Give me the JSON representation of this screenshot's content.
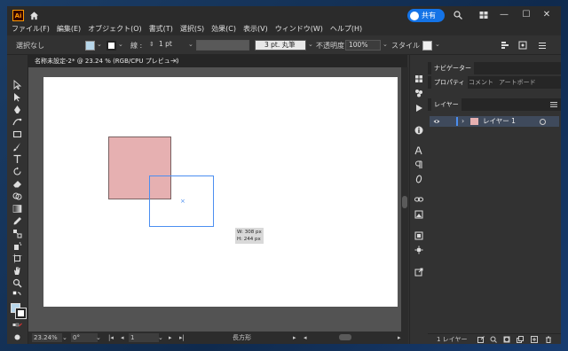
{
  "app": {
    "logo": "Ai",
    "home_icon": "home-icon",
    "share_label": "共有",
    "colors": {
      "accent": "#1473e6",
      "artwork_fill": "#e6b0b1",
      "selection": "#4b8ef0",
      "brand": "#ff9a00"
    }
  },
  "menu": [
    {
      "label": "ファイル(F)"
    },
    {
      "label": "編集(E)"
    },
    {
      "label": "オブジェクト(O)"
    },
    {
      "label": "書式(T)"
    },
    {
      "label": "選択(S)"
    },
    {
      "label": "効果(C)"
    },
    {
      "label": "表示(V)"
    },
    {
      "label": "ウィンドウ(W)"
    },
    {
      "label": "ヘルプ(H)"
    }
  ],
  "window_controls": {
    "minimize": "—",
    "maximize": "☐",
    "close": "✕"
  },
  "control_bar": {
    "selection_label": "選択なし",
    "stroke_label": "線 :",
    "stroke_weight": "1 pt",
    "brush_label": "3 pt. 丸筆",
    "opacity_label": "不透明度 :",
    "opacity_value": "100%",
    "style_label": "スタイル :"
  },
  "document_tab": {
    "title": "名称未設定-2* @ 23.24 % (RGB/CPU プレビュー)",
    "close": "×"
  },
  "canvas": {
    "tooltip_w": "W: 308 px",
    "tooltip_h": "H: 244 px",
    "center_mark": "×"
  },
  "status_bar": {
    "zoom": "23.24%",
    "rotation": "0°",
    "artboard_number": "1",
    "tool_name": "長方形"
  },
  "panels": {
    "tabs_top": [
      {
        "label": "ナビゲーター"
      }
    ],
    "tabs_mid": [
      {
        "label": "プロパティ"
      },
      {
        "label": "コメント"
      },
      {
        "label": "アートボード"
      }
    ],
    "tabs_layers": [
      {
        "label": "レイヤー"
      }
    ],
    "layer": {
      "name": "レイヤー 1"
    },
    "layer_count": "1 レイヤー"
  }
}
